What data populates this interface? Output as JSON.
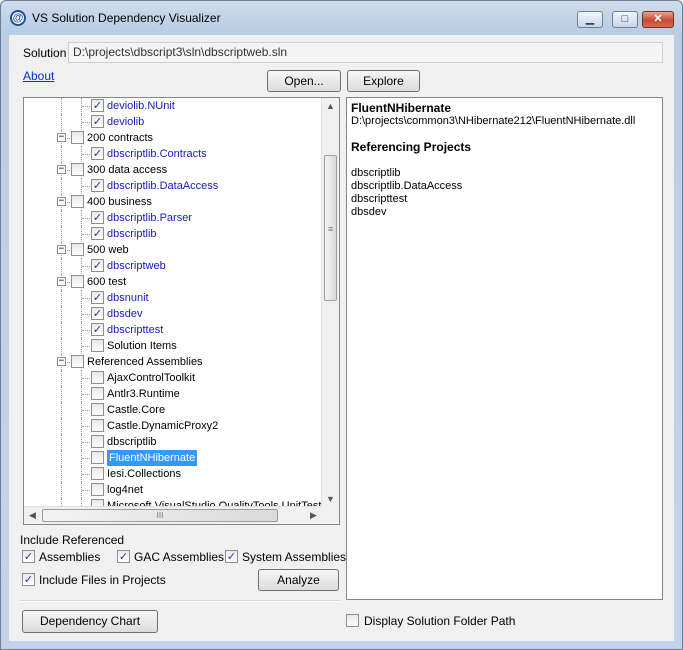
{
  "window": {
    "title": "VS Solution Dependency Visualizer",
    "min_glyph": "▁",
    "max_glyph": "□",
    "close_glyph": "✕"
  },
  "solution": {
    "label": "Solution",
    "path": "D:\\projects\\dbscript3\\sln\\dbscriptweb.sln"
  },
  "links": {
    "about": "About"
  },
  "buttons": {
    "open": "Open...",
    "explore": "Explore",
    "analyze": "Analyze",
    "dependency_chart": "Dependency Chart"
  },
  "tree": {
    "nodes": [
      {
        "text": "deviolib.NUnit",
        "level": 2,
        "checked": true,
        "blue": true
      },
      {
        "text": "deviolib",
        "level": 2,
        "checked": true,
        "blue": true
      },
      {
        "text": "200 contracts",
        "level": 1,
        "checked": false,
        "blue": false,
        "expander": "−"
      },
      {
        "text": "dbscriptlib.Contracts",
        "level": 2,
        "checked": true,
        "blue": true
      },
      {
        "text": "300 data access",
        "level": 1,
        "checked": false,
        "blue": false,
        "expander": "−"
      },
      {
        "text": "dbscriptlib.DataAccess",
        "level": 2,
        "checked": true,
        "blue": true
      },
      {
        "text": "400 business",
        "level": 1,
        "checked": false,
        "blue": false,
        "expander": "−"
      },
      {
        "text": "dbscriptlib.Parser",
        "level": 2,
        "checked": true,
        "blue": true
      },
      {
        "text": "dbscriptlib",
        "level": 2,
        "checked": true,
        "blue": true
      },
      {
        "text": "500 web",
        "level": 1,
        "checked": false,
        "blue": false,
        "expander": "−"
      },
      {
        "text": "dbscriptweb",
        "level": 2,
        "checked": true,
        "blue": true
      },
      {
        "text": "600 test",
        "level": 1,
        "checked": false,
        "blue": false,
        "expander": "−"
      },
      {
        "text": "dbsnunit",
        "level": 2,
        "checked": true,
        "blue": true
      },
      {
        "text": "dbsdev",
        "level": 2,
        "checked": true,
        "blue": true
      },
      {
        "text": "dbscripttest",
        "level": 2,
        "checked": true,
        "blue": true
      },
      {
        "text": "Solution Items",
        "level": 2,
        "checked": false,
        "blue": false
      },
      {
        "text": "Referenced Assemblies",
        "level": 1,
        "checked": false,
        "blue": false,
        "expander": "−"
      },
      {
        "text": "AjaxControlToolkit",
        "level": 2,
        "checked": false,
        "blue": false
      },
      {
        "text": "Antlr3.Runtime",
        "level": 2,
        "checked": false,
        "blue": false
      },
      {
        "text": "Castle.Core",
        "level": 2,
        "checked": false,
        "blue": false
      },
      {
        "text": "Castle.DynamicProxy2",
        "level": 2,
        "checked": false,
        "blue": false
      },
      {
        "text": "dbscriptlib",
        "level": 2,
        "checked": false,
        "blue": false
      },
      {
        "text": "FluentNHibernate",
        "level": 2,
        "checked": false,
        "blue": false,
        "selected": true
      },
      {
        "text": "Iesi.Collections",
        "level": 2,
        "checked": false,
        "blue": false
      },
      {
        "text": "log4net",
        "level": 2,
        "checked": false,
        "blue": false
      },
      {
        "text": "Microsoft.VisualStudio.QualityTools.UnitTestFr",
        "level": 2,
        "checked": false,
        "blue": false
      }
    ],
    "check_glyph": "✓",
    "scroll_up": "▲",
    "scroll_down": "▼",
    "scroll_left": "◀",
    "scroll_right": "▶",
    "vthumb_grip": "≡",
    "hthumb_grip": "III"
  },
  "details": {
    "assembly_name": "FluentNHibernate",
    "assembly_path": "D:\\projects\\common3\\NHibernate212\\FluentNHibernate.dll",
    "referencing_heading": "Referencing Projects",
    "referencing_projects": [
      "dbscriptlib",
      "dbscriptlib.DataAccess",
      "dbscripttest",
      "dbsdev"
    ]
  },
  "options": {
    "include_referenced_label": "Include Referenced",
    "assemblies": {
      "label": "Assemblies",
      "checked": true
    },
    "gac_assemblies": {
      "label": "GAC Assemblies",
      "checked": true
    },
    "system_assemblies": {
      "label": "System Assemblies",
      "checked": true
    },
    "include_files": {
      "label": "Include Files in Projects",
      "checked": true
    },
    "display_folder_path": {
      "label": "Display Solution Folder Path",
      "checked": false
    }
  },
  "colors": {
    "blue_node": "#1a1ab4",
    "selection": "#3399ff",
    "link": "#0033cc"
  }
}
